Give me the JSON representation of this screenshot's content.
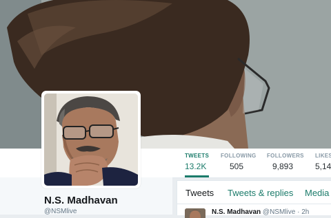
{
  "profile": {
    "name": "N.S. Madhavan",
    "handle": "@NSMlive"
  },
  "stats": [
    {
      "label": "TWEETS",
      "value": "13.2K",
      "active": true
    },
    {
      "label": "FOLLOWING",
      "value": "505",
      "active": false
    },
    {
      "label": "FOLLOWERS",
      "value": "9,893",
      "active": false
    },
    {
      "label": "LIKES",
      "value": "5,14",
      "active": false
    }
  ],
  "timeline": {
    "tabs": [
      "Tweets",
      "Tweets & replies",
      "Media"
    ],
    "tweet": {
      "name": "N.S. Madhavan",
      "handle": "@NSMlive",
      "separator": "·",
      "time": "2h"
    }
  },
  "colors": {
    "accent": "#1b7b6a",
    "text": "#14171a",
    "muted": "#657786"
  },
  "icons": {
    "cover": "cover-photo",
    "avatar": "profile-avatar"
  }
}
